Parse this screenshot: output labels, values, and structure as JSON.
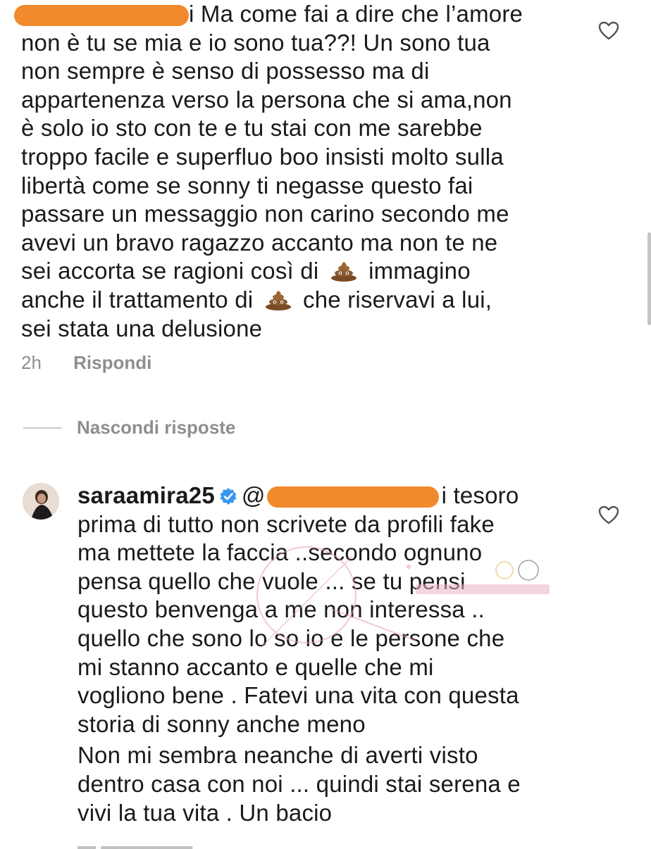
{
  "comment1": {
    "text_line1": "i Ma come fai a dire che l’amore",
    "lines": [
      "non è tu se mia e io sono tua??! Un sono tua",
      "non sempre è senso di possesso ma di",
      "appartenenza verso la persona che si ama,non",
      "è solo io sto con te e tu stai con me sarebbe",
      "troppo facile e superfluo boo insisti molto sulla",
      "libertà come se sonny ti negasse questo fai",
      "passare un messaggio non carino secondo me",
      "avevi un bravo ragazzo accanto ma non te ne"
    ],
    "line10a": "sei accorta se ragioni così di",
    "line10b": "immagino",
    "line11a": "anche il trattamento di",
    "line11b": "che riservavi a lui,",
    "line12": "sei stata una delusione",
    "time": "2h",
    "reply_label": "Rispondi"
  },
  "hide_replies_label": "Nascondi risposte",
  "comment2": {
    "username": "saraamira25",
    "mention_prefix": "@",
    "line1_tail": "i tesoro",
    "lines": [
      "prima di tutto non scrivete da profili fake",
      "ma mettete la faccia ..secondo ognuno",
      "pensa quello che vuole ... se tu pensi",
      "questo benvenga a me non interessa ..",
      "quello che sono lo so io e le persone che",
      "mi stanno accanto e quelle che mi",
      "vogliono bene . Fatevi una vita con questa",
      "storia di sonny anche meno",
      "Non mi sembra neanche di averti visto",
      "dentro casa con noi ... quindi stai serena e",
      "vivi la tua vita . Un bacio"
    ]
  },
  "icons": {
    "like1": "heart-outline-icon",
    "like2": "heart-outline-icon",
    "verified": "verified-badge-icon",
    "poop": "poop-emoji-icon"
  },
  "colors": {
    "redaction": "#f08a2c",
    "verified": "#3897f0",
    "meta": "#8e8e8e"
  }
}
